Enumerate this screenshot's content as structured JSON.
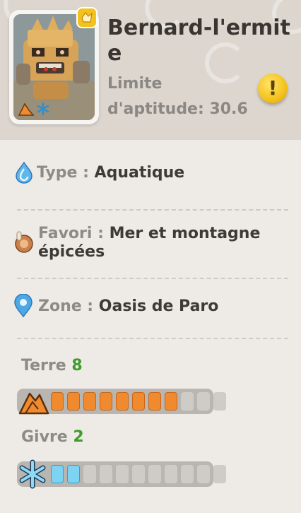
{
  "creature": {
    "name": "Bernard-l'ermite",
    "aptitude": "Limite d'aptitude: 30.6"
  },
  "info": {
    "type_label": "Type :",
    "type_value": "Aquatique",
    "favorite_label": "Favori :",
    "favorite_value": "Mer et montagne épicées",
    "zone_label": "Zone :",
    "zone_value": "Oasis de Paro"
  },
  "stats": [
    {
      "label": "Terre",
      "value": "8",
      "level": 8,
      "max": 11,
      "color": "#f08a2f",
      "icon": "earth-icon"
    },
    {
      "label": "Givre",
      "value": "2",
      "level": 2,
      "max": 11,
      "color": "#7ed3f2",
      "icon": "snowflake-icon"
    }
  ],
  "colors": {
    "header_bg": "#dcd6cf",
    "body_bg": "#eeebe6",
    "stat_number": "#3f9b2d",
    "warning": "#f4c21d"
  }
}
